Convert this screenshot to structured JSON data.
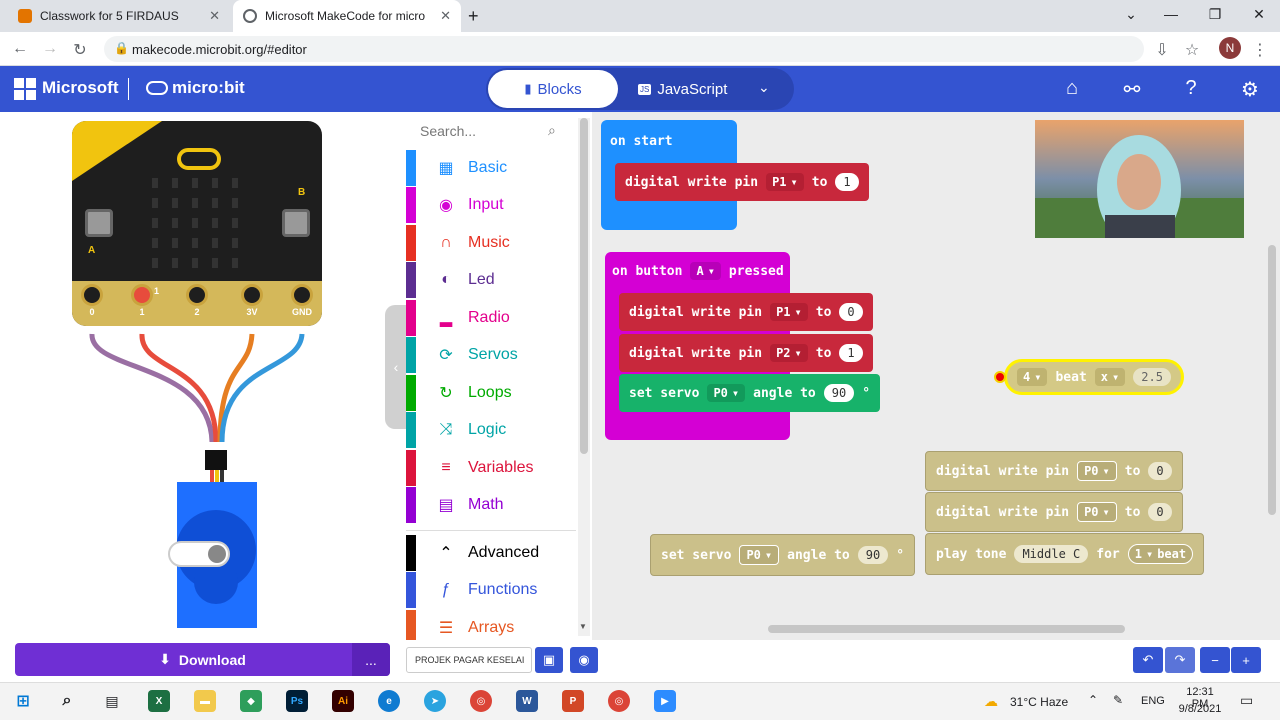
{
  "browser": {
    "tabs": [
      {
        "title": "Classwork for 5 FIRDAUS",
        "favicon_color": "#e37400"
      },
      {
        "title": "Microsoft MakeCode for micro:b",
        "favicon_color": "#5f6368"
      }
    ],
    "new_tab": "+",
    "url": "makecode.microbit.org/#editor",
    "profile_initial": "N"
  },
  "header": {
    "brand": "Microsoft",
    "product": "micro:bit",
    "mode_blocks": "Blocks",
    "mode_js": "JavaScript"
  },
  "simulator": {
    "pins": [
      "0",
      "1",
      "2",
      "3V",
      "GND"
    ],
    "button_a": "A",
    "button_b": "B",
    "pin1_label": "1",
    "download": "Download",
    "more": "..."
  },
  "toolbox": {
    "search_placeholder": "Search...",
    "categories": [
      {
        "label": "Basic",
        "color": "#1e90ff",
        "icon": "grid-icon"
      },
      {
        "label": "Input",
        "color": "#d400d4",
        "icon": "target-icon"
      },
      {
        "label": "Music",
        "color": "#e63022",
        "icon": "headphones-icon"
      },
      {
        "label": "Led",
        "color": "#5c2d91",
        "icon": "toggle-icon"
      },
      {
        "label": "Radio",
        "color": "#e3008c",
        "icon": "signal-icon"
      },
      {
        "label": "Servos",
        "color": "#00a4a6",
        "icon": "refresh-icon"
      },
      {
        "label": "Loops",
        "color": "#00aa00",
        "icon": "loop-icon"
      },
      {
        "label": "Logic",
        "color": "#00a4a6",
        "icon": "shuffle-icon"
      },
      {
        "label": "Variables",
        "color": "#dc143c",
        "icon": "lines-icon"
      },
      {
        "label": "Math",
        "color": "#9400d3",
        "icon": "calculator-icon"
      }
    ],
    "advanced": [
      {
        "label": "Advanced",
        "color": "#000000",
        "icon": "chevron-up-icon"
      },
      {
        "label": "Functions",
        "color": "#3455db",
        "icon": "function-icon"
      },
      {
        "label": "Arrays",
        "color": "#e65722",
        "icon": "list-icon"
      }
    ]
  },
  "workspace": {
    "on_start": {
      "header": "on start",
      "write_label": "digital write pin",
      "pin": "P1",
      "to": "to",
      "value": "1"
    },
    "on_button": {
      "header": "on button",
      "button": "A",
      "pressed": "pressed",
      "rows": [
        {
          "label": "digital write pin",
          "pin": "P1",
          "to": "to",
          "value": "0"
        },
        {
          "label": "digital write pin",
          "pin": "P2",
          "to": "to",
          "value": "1"
        }
      ],
      "servo_label": "set servo",
      "servo_pin": "P0",
      "angle_label": "angle to",
      "angle_value": "90",
      "degree": "°"
    },
    "beat_block": {
      "count": "4",
      "beat": "beat",
      "op": "x",
      "value": "2.5"
    },
    "loose_stack": {
      "rows": [
        {
          "label": "digital write pin",
          "pin": "P0",
          "to": "to",
          "value": "0"
        },
        {
          "label": "digital write pin",
          "pin": "P0",
          "to": "to",
          "value": "0"
        }
      ],
      "tone_label": "play tone",
      "tone_value": "Middle C",
      "for": "for",
      "beat_count": "1",
      "beat": "beat"
    },
    "loose_servo": {
      "label": "set servo",
      "pin": "P0",
      "angle_label": "angle to",
      "angle_value": "90",
      "degree": "°"
    }
  },
  "bottom": {
    "project_name": "PROJEK PAGAR KESELAI"
  },
  "taskbar": {
    "weather": "31°C  Haze",
    "lang": "ENG",
    "time": "12:31 PM",
    "date": "9/8/2021"
  }
}
